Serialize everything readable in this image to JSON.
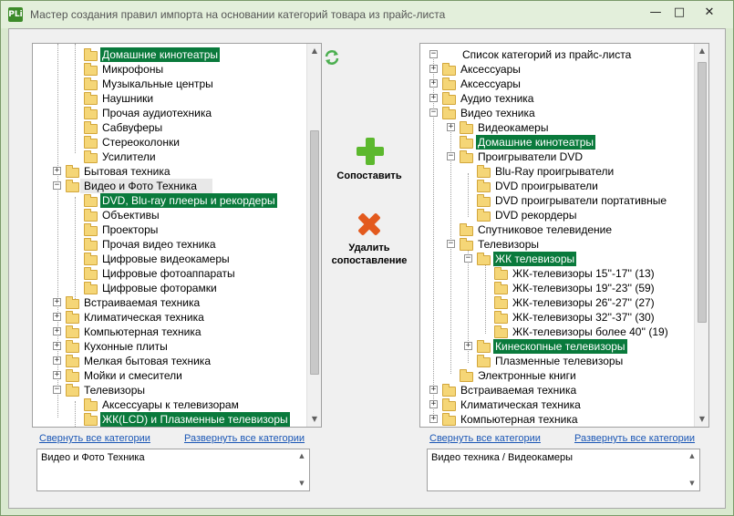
{
  "window": {
    "title": "Мастер создания правил импорта на основании категорий товара из прайс-листа",
    "icon_text": "PLi",
    "minimize_glyph": "—",
    "maximize_glyph": "□",
    "close_glyph": "✕"
  },
  "left_tree": {
    "rows": [
      {
        "label": "Домашние кинотеатры",
        "highlight": true
      },
      {
        "label": "Микрофоны"
      },
      {
        "label": "Музыкальные центры"
      },
      {
        "label": "Наушники"
      },
      {
        "label": "Прочая аудиотехника"
      },
      {
        "label": "Сабвуферы"
      },
      {
        "label": "Стереоколонки"
      },
      {
        "label": "Усилители"
      },
      {
        "label": "Бытовая техника",
        "expander": "+"
      },
      {
        "label": "Видео и Фото Техника",
        "expander": "−",
        "selected": true
      },
      {
        "label": "DVD, Blu-ray плееры и рекордеры",
        "highlight": true
      },
      {
        "label": "Объективы"
      },
      {
        "label": "Проекторы"
      },
      {
        "label": "Прочая видео техника"
      },
      {
        "label": "Цифровые видеокамеры"
      },
      {
        "label": "Цифровые фотоаппараты"
      },
      {
        "label": "Цифровые фоторамки"
      },
      {
        "label": "Встраиваемая техника",
        "expander": "+"
      },
      {
        "label": "Климатическая техника",
        "expander": "+"
      },
      {
        "label": "Компьютерная техника",
        "expander": "+"
      },
      {
        "label": "Кухонные плиты",
        "expander": "+"
      },
      {
        "label": "Мелкая бытовая техника",
        "expander": "+"
      },
      {
        "label": "Мойки и смесители",
        "expander": "+"
      },
      {
        "label": "Телевизоры",
        "expander": "−"
      },
      {
        "label": "Аксессуары к телевизорам"
      },
      {
        "label": "ЖК(LCD) и Плазменные телевизоры",
        "highlight": true
      }
    ],
    "collapse_all": "Свернуть все категории",
    "expand_all": "Развернуть все категории",
    "memo_text": "Видео и Фото Техника"
  },
  "right_tree": {
    "rows": [
      {
        "label": "Список категорий из прайс-листа",
        "expander": "−",
        "depth": 0,
        "root": true
      },
      {
        "label": "Аксессуары",
        "expander": "+",
        "depth": 1
      },
      {
        "label": "Аксессуары",
        "expander": "+",
        "depth": 1
      },
      {
        "label": "Аудио техника",
        "expander": "+",
        "depth": 1
      },
      {
        "label": "Видео техника",
        "expander": "−",
        "depth": 1
      },
      {
        "label": "Видеокамеры",
        "expander": "+",
        "depth": 2
      },
      {
        "label": "Домашние кинотеатры",
        "depth": 2,
        "highlight": true
      },
      {
        "label": "Проигрыватели DVD",
        "expander": "−",
        "depth": 2
      },
      {
        "label": "Blu-Ray проигрыватели",
        "depth": 3
      },
      {
        "label": "DVD проигрыватели",
        "depth": 3
      },
      {
        "label": "DVD проигрыватели портативные",
        "depth": 3
      },
      {
        "label": "DVD рекордеры",
        "depth": 3
      },
      {
        "label": "Спутниковое телевидение",
        "depth": 2
      },
      {
        "label": "Телевизоры",
        "expander": "−",
        "depth": 2
      },
      {
        "label": "ЖК телевизоры",
        "expander": "−",
        "depth": 3,
        "highlight": true
      },
      {
        "label": "ЖК-телевизоры 15''-17'' (13)",
        "depth": 4
      },
      {
        "label": "ЖК-телевизоры 19''-23'' (59)",
        "depth": 4
      },
      {
        "label": "ЖК-телевизоры 26''-27'' (27)",
        "depth": 4
      },
      {
        "label": "ЖК-телевизоры 32''-37'' (30)",
        "depth": 4
      },
      {
        "label": "ЖК-телевизоры более 40'' (19)",
        "depth": 4
      },
      {
        "label": "Кинескопные телевизоры",
        "expander": "+",
        "depth": 3,
        "highlight": true
      },
      {
        "label": "Плазменные телевизоры",
        "depth": 3
      },
      {
        "label": "Электронные книги",
        "depth": 2
      },
      {
        "label": "Встраиваемая техника",
        "expander": "+",
        "depth": 1
      },
      {
        "label": "Климатическая техника",
        "expander": "+",
        "depth": 1
      },
      {
        "label": "Компьютерная техника",
        "expander": "+",
        "depth": 1
      }
    ],
    "collapse_all": "Свернуть все категории",
    "expand_all": "Развернуть все категории",
    "memo_text": "Видео техника / Видеокамеры"
  },
  "actions": {
    "refresh_icon": "refresh-icon",
    "match_label": "Сопоставить",
    "delete_label_1": "Удалить",
    "delete_label_2": "сопоставление"
  },
  "colors": {
    "highlight": "#0a7a3c",
    "plus": "#5cb82e",
    "delete": "#e35a1e",
    "folder": "#f5d677"
  }
}
